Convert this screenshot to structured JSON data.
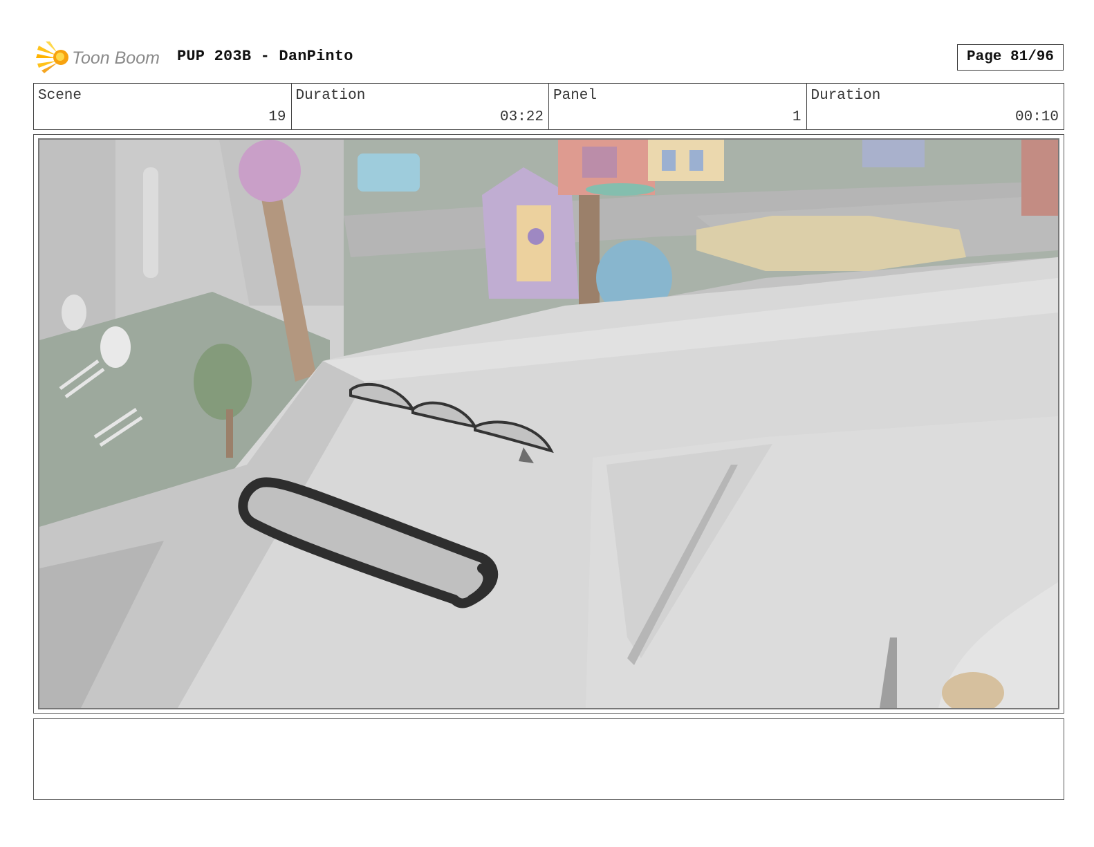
{
  "header": {
    "logo_text": "Toon Boom",
    "title": "PUP 203B - DanPinto",
    "page_label": "Page 81/96"
  },
  "info": [
    {
      "label": "Scene",
      "value": "19"
    },
    {
      "label": "Duration",
      "value": "03:22"
    },
    {
      "label": "Panel",
      "value": "1"
    },
    {
      "label": "Duration",
      "value": "00:10"
    }
  ],
  "panel": {
    "icon": "storyboard-sketch-image"
  },
  "notes": {
    "text": ""
  },
  "colors": {
    "logo_orange": "#f5a623",
    "logo_yellow": "#ffd21f",
    "logo_gray": "#8a8a8a",
    "frame_border": "#444444"
  }
}
